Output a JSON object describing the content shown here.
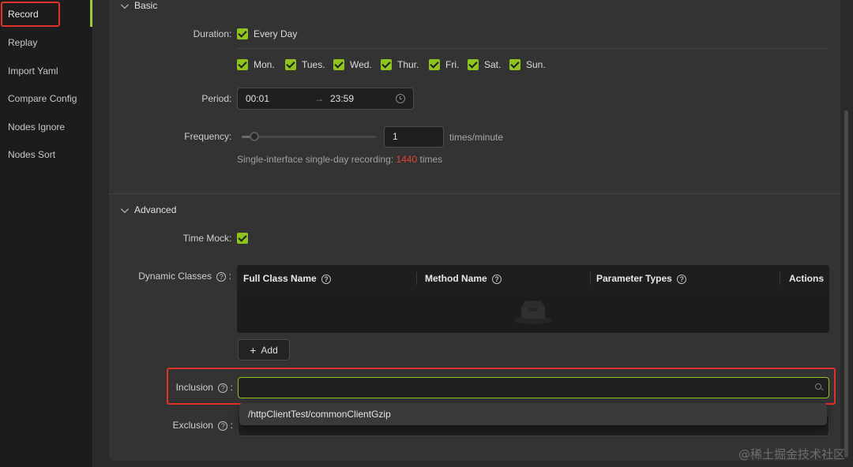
{
  "sidebar": {
    "items": [
      {
        "label": "Record"
      },
      {
        "label": "Replay"
      },
      {
        "label": "Import Yaml"
      },
      {
        "label": "Compare Config"
      },
      {
        "label": "Nodes Ignore"
      },
      {
        "label": "Nodes Sort"
      }
    ]
  },
  "basic": {
    "title": "Basic",
    "duration_label": "Duration",
    "every_day_label": "Every Day",
    "days": [
      "Mon.",
      "Tues.",
      "Wed.",
      "Thur.",
      "Fri.",
      "Sat.",
      "Sun."
    ],
    "period_label": "Period",
    "period_from": "00:01",
    "period_to": "23:59",
    "period_arrow": "→",
    "frequency_label": "Frequency",
    "frequency_value": "1",
    "frequency_slider_value": 1,
    "frequency_unit": "times/minute",
    "hint_prefix": "Single-interface single-day recording:",
    "hint_count": "1440",
    "hint_suffix": "times"
  },
  "advanced": {
    "title": "Advanced",
    "time_mock_label": "Time Mock",
    "dynamic_classes_label": "Dynamic Classes",
    "table_headers": {
      "full_class_name": "Full Class Name",
      "method_name": "Method Name",
      "parameter_types": "Parameter Types",
      "actions": "Actions"
    },
    "add_label": "Add",
    "inclusion_label": "Inclusion",
    "inclusion_value": "",
    "exclusion_label": "Exclusion",
    "dropdown_options": [
      "/httpClientTest/commonClientGzip"
    ]
  },
  "colon": ":",
  "watermark": "@稀土掘金技术社区",
  "colors": {
    "accent": "#8fc31f",
    "highlight": "#e0322b",
    "count_red": "#e0443a"
  }
}
